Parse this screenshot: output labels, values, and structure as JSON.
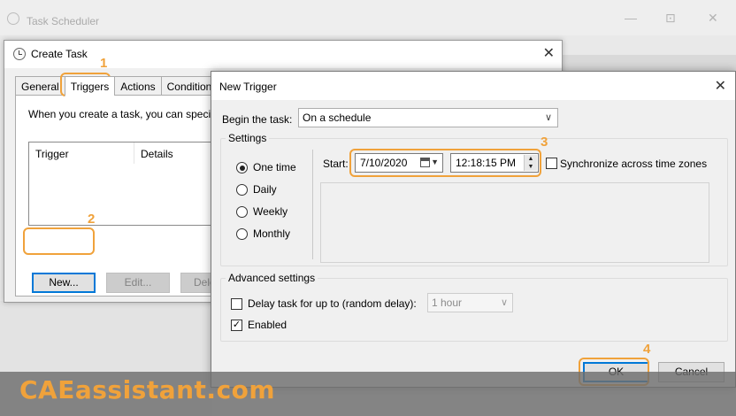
{
  "background_app": {
    "title": "Task Scheduler"
  },
  "create_task": {
    "title": "Create Task",
    "tabs": [
      "General",
      "Triggers",
      "Actions",
      "Conditions"
    ],
    "active_tab": "Triggers",
    "description": "When you create a task, you can specify",
    "list_headers": {
      "trigger": "Trigger",
      "details": "Details"
    },
    "buttons": {
      "new": "New...",
      "edit": "Edit...",
      "delete": "Dele"
    }
  },
  "new_trigger": {
    "title": "New Trigger",
    "begin_label": "Begin the task:",
    "begin_value": "On a schedule",
    "settings_title": "Settings",
    "schedule_options": [
      "One time",
      "Daily",
      "Weekly",
      "Monthly"
    ],
    "selected_option": "One time",
    "start_label": "Start:",
    "start_date": "7/10/2020",
    "start_time": "12:18:15 PM",
    "sync_label": "Synchronize across time zones",
    "sync_checked": false,
    "advanced_title": "Advanced settings",
    "delay_label": "Delay task for up to (random delay):",
    "delay_checked": false,
    "delay_value": "1 hour",
    "enabled_label": "Enabled",
    "enabled_checked": true,
    "ok_label": "OK",
    "cancel_label": "Cancel"
  },
  "annotations": {
    "step1": "1",
    "step2": "2",
    "step3": "3",
    "step4": "4",
    "highlight_color": "#f0a23b"
  },
  "watermark": "CAEassistant.com"
}
